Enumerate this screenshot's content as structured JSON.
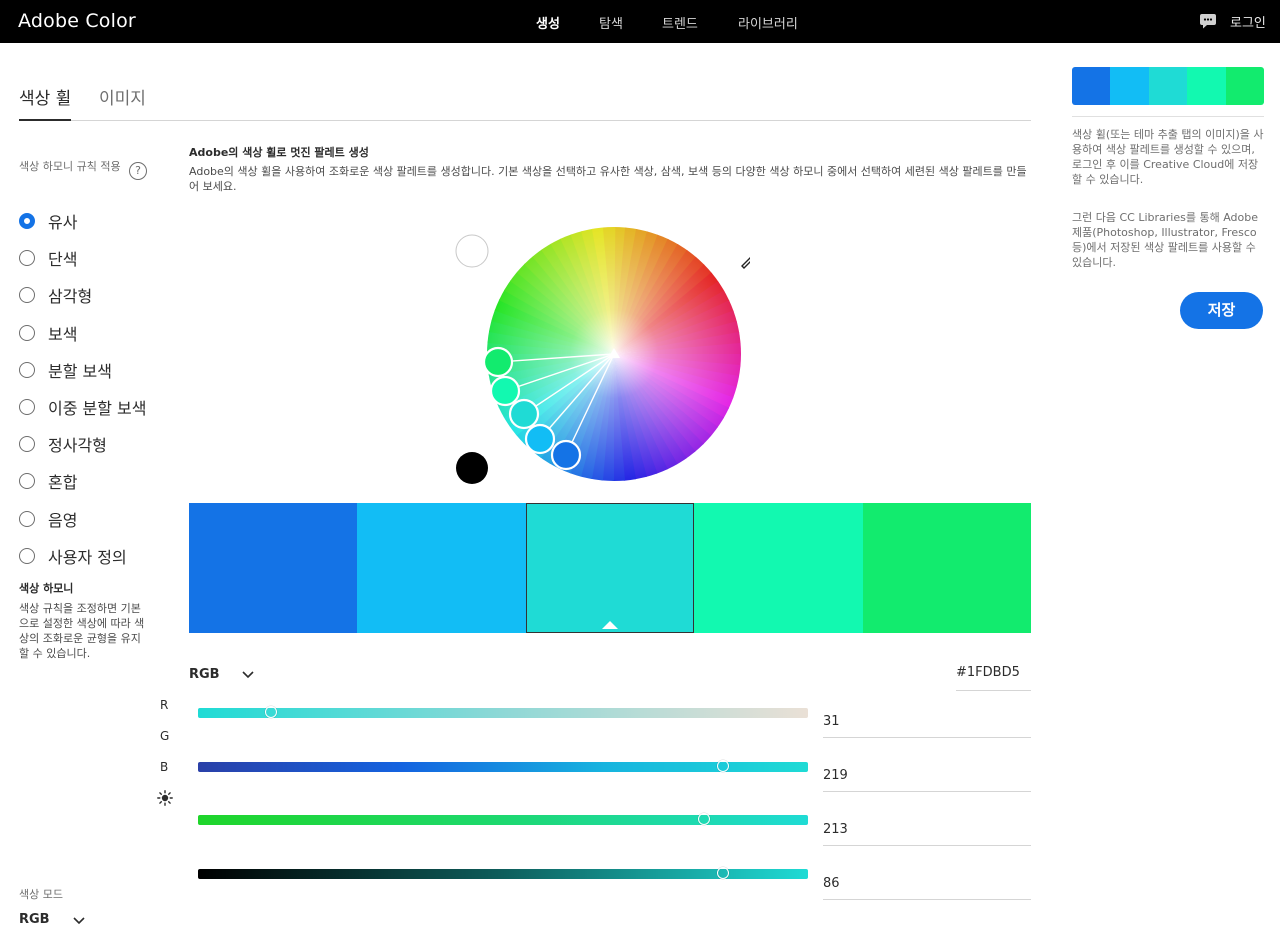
{
  "app": {
    "title": "Adobe Color",
    "nav": [
      {
        "label": "생성",
        "active": true
      },
      {
        "label": "탐색",
        "active": false
      },
      {
        "label": "트렌드",
        "active": false
      },
      {
        "label": "라이브러리",
        "active": false
      }
    ],
    "login_label": "로그인",
    "chat_icon": "chat-bubble-icon"
  },
  "left": {
    "tabs": [
      "색상 휠",
      "이미지"
    ],
    "active_tab": "색상 휠",
    "harmony_title": "색상 하모니 규칙 적용",
    "help_glyph": "?",
    "rules": [
      {
        "label": "유사",
        "selected": true
      },
      {
        "label": "단색",
        "selected": false
      },
      {
        "label": "삼각형",
        "selected": false
      },
      {
        "label": "보색",
        "selected": false
      },
      {
        "label": "분할 보색",
        "selected": false
      },
      {
        "label": "이중 분할 보색",
        "selected": false
      },
      {
        "label": "정사각형",
        "selected": false
      },
      {
        "label": "혼합",
        "selected": false
      },
      {
        "label": "음영",
        "selected": false
      },
      {
        "label": "사용자 정의",
        "selected": false
      }
    ],
    "harmony_heading": "색상 하모니",
    "harmony_desc": "색상 규칙을 조정하면 기본으로 설정한 색상에 따라 색상의 조화로운 균형을 유지할 수 있습니다.",
    "mode_label": "색상 모드",
    "mode_value": "RGB"
  },
  "center": {
    "heading": "Adobe의 색상 휠로 멋진 팔레트 생성",
    "description": "Adobe의 색상 휠을 사용하여 조화로운 색상 팔레트를 생성합니다. 기본 색상을 선택하고 유사한 색상, 삼색, 보색 등의 다양한 색상 하모니 중에서 선택하여 세련된 색상 팔레트를 만들어 보세요.",
    "palette": [
      "#1473E6",
      "#12BDF5",
      "#1FDBD5",
      "#12F9B0",
      "#12EB6E"
    ],
    "selected_index": 2,
    "channel_mode": "RGB",
    "hex_value": "#1FDBD5",
    "channels": [
      {
        "label": "R",
        "value": "31",
        "fraction": 0.12
      },
      {
        "label": "G",
        "value": "219",
        "fraction": 0.86
      },
      {
        "label": "B",
        "value": "213",
        "fraction": 0.83
      },
      {
        "label": "brightness-icon",
        "value": "86",
        "fraction": 0.86
      }
    ]
  },
  "right": {
    "palette": [
      "#1473E6",
      "#12BDF5",
      "#1FDBD5",
      "#12F9B0",
      "#12EB6E"
    ],
    "para1": "색상 휠(또는 테마 추출 탭의 이미지)을 사용하여 색상 팔레트를 생성할 수 있으며, 로그인 후 이를 Creative Cloud에 저장할 수 있습니다.",
    "para2": "그런 다음 CC Libraries를 통해 Adobe 제품(Photoshop, Illustrator, Fresco 등)에서 저장된 색상 팔레트를 사용할 수 있습니다.",
    "save_label": "저장"
  }
}
